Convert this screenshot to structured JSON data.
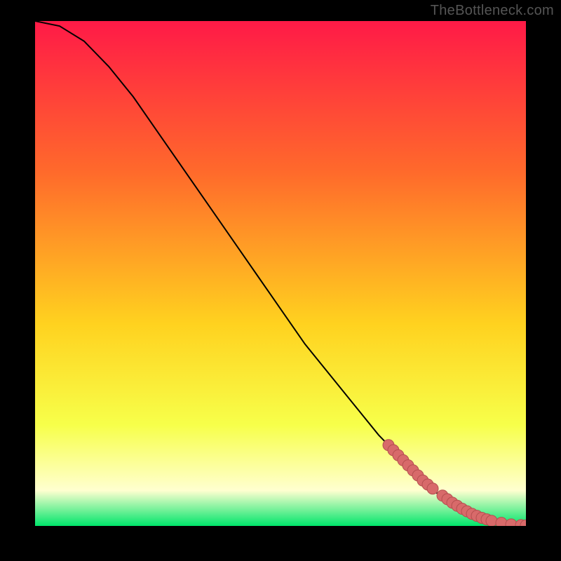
{
  "watermark": "TheBottleneck.com",
  "colors": {
    "background": "#000000",
    "gradient_top": "#ff1a47",
    "gradient_upper_mid": "#ff6a2b",
    "gradient_mid": "#ffd21f",
    "gradient_lower_mid": "#f7ff4a",
    "gradient_pale": "#ffffd0",
    "gradient_bottom": "#00e56b",
    "curve": "#000000",
    "marker_fill": "#d86a6a",
    "marker_stroke": "#b44f4f"
  },
  "chart_data": {
    "type": "line",
    "title": "",
    "xlabel": "",
    "ylabel": "",
    "xlim": [
      0,
      100
    ],
    "ylim": [
      0,
      100
    ],
    "series": [
      {
        "name": "curve",
        "x": [
          0,
          5,
          10,
          15,
          20,
          25,
          30,
          35,
          40,
          45,
          50,
          55,
          60,
          65,
          70,
          75,
          80,
          85,
          88,
          90,
          92,
          94,
          96,
          98,
          100
        ],
        "y": [
          100,
          99,
          96,
          91,
          85,
          78,
          71,
          64,
          57,
          50,
          43,
          36,
          30,
          24,
          18,
          13,
          8,
          4,
          2,
          1.2,
          0.7,
          0.4,
          0.2,
          0.1,
          0.05
        ]
      }
    ],
    "markers": {
      "name": "highlight-points",
      "x": [
        72,
        73,
        74,
        75,
        76,
        77,
        78,
        79,
        80,
        81,
        83,
        84,
        85,
        86,
        87,
        88,
        89,
        90,
        91,
        92,
        93,
        95,
        97,
        99,
        100
      ],
      "y": [
        16,
        15,
        14,
        13,
        12,
        11,
        10,
        9,
        8.2,
        7.4,
        6,
        5.3,
        4.6,
        4,
        3.4,
        2.9,
        2.4,
        2,
        1.6,
        1.3,
        1,
        0.6,
        0.3,
        0.15,
        0.1
      ]
    }
  }
}
